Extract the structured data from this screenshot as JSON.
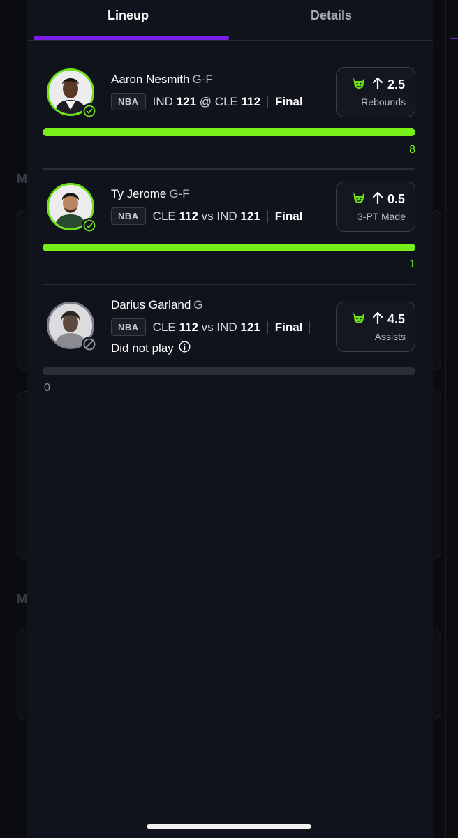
{
  "tabs": [
    {
      "label": "Lineup",
      "active": true
    },
    {
      "label": "Details",
      "active": false
    }
  ],
  "accent_color": "#7a20e6",
  "progress_color": "#77ef18",
  "players": [
    {
      "name": "Aaron Nesmith",
      "position": "G-F",
      "league": "NBA",
      "matchup": {
        "team1": "IND",
        "score1": "121",
        "connector": "@",
        "team2": "CLE",
        "score2": "112"
      },
      "game_status": "Final",
      "status_icon": "check-circle-icon",
      "pick": {
        "icon": "demon-icon",
        "direction_icon": "arrow-up-icon",
        "line": "2.5",
        "stat": "Rebounds"
      },
      "result": "8",
      "progress": 1.0,
      "note": ""
    },
    {
      "name": "Ty Jerome",
      "position": "G-F",
      "league": "NBA",
      "matchup": {
        "team1": "CLE",
        "score1": "112",
        "connector": "vs",
        "team2": "IND",
        "score2": "121"
      },
      "game_status": "Final",
      "status_icon": "check-circle-icon",
      "pick": {
        "icon": "demon-icon",
        "direction_icon": "arrow-up-icon",
        "line": "0.5",
        "stat": "3-PT Made"
      },
      "result": "1",
      "progress": 1.0,
      "note": ""
    },
    {
      "name": "Darius Garland",
      "position": "G",
      "league": "NBA",
      "matchup": {
        "team1": "CLE",
        "score1": "112",
        "connector": "vs",
        "team2": "IND",
        "score2": "121"
      },
      "game_status": "Final",
      "status_icon": "blocked-circle-icon",
      "pick": {
        "icon": "demon-icon",
        "direction_icon": "arrow-up-icon",
        "line": "4.5",
        "stat": "Assists"
      },
      "result": "0",
      "progress": 0.0,
      "note": "Did not play"
    }
  ]
}
